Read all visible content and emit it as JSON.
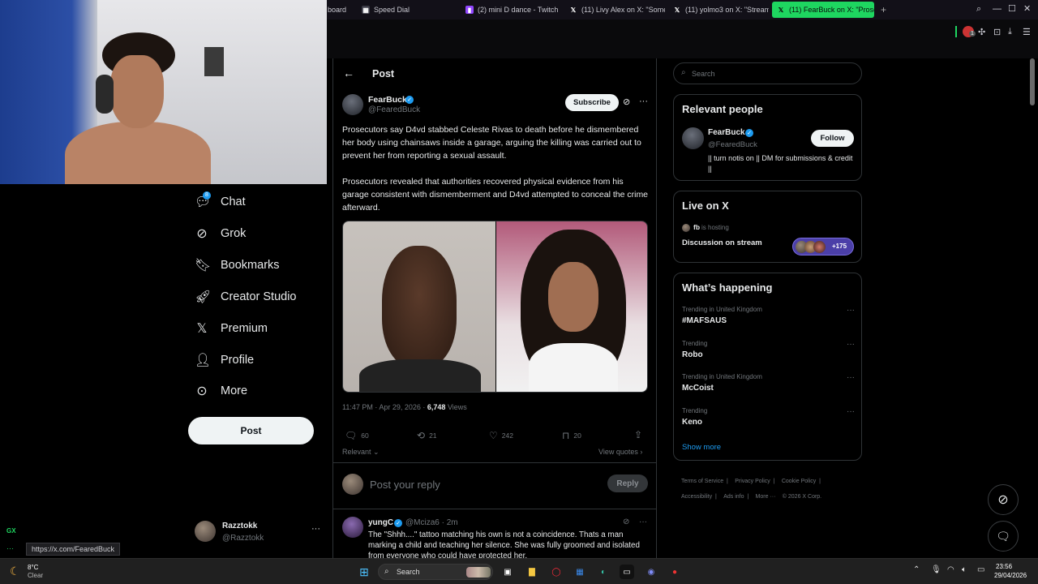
{
  "browser": {
    "tabs": [
      {
        "label": "board"
      },
      {
        "label": "Speed Dial"
      },
      {
        "label": "(2) mini D dance - Twitch"
      },
      {
        "label": "(11) Livy Alex on X: \"Some"
      },
      {
        "label": "(11) yolmo3 on X: \"Stream"
      },
      {
        "label": "(11) FearBuck on X: \"Prose",
        "active": true
      }
    ],
    "new_tab": "+",
    "gx_label": "GX",
    "toolbar_badge": "1"
  },
  "nav": {
    "chat_badge": "8",
    "items": [
      {
        "label": "Chat",
        "icon": "chat-icon"
      },
      {
        "label": "Grok",
        "icon": "grok-icon"
      },
      {
        "label": "Bookmarks",
        "icon": "bookmark-icon"
      },
      {
        "label": "Creator Studio",
        "icon": "rocket-icon"
      },
      {
        "label": "Premium",
        "icon": "x-logo-icon"
      },
      {
        "label": "Profile",
        "icon": "person-icon"
      },
      {
        "label": "More",
        "icon": "more-circle-icon"
      }
    ],
    "post_button": "Post",
    "account": {
      "name": "Razztokk",
      "handle": "@Razztokk",
      "menu": "···"
    }
  },
  "status_url": "https://x.com/FearedBuck",
  "post": {
    "header_title": "Post",
    "author_name": "FearBuck",
    "author_handle": "@FearedBuck",
    "subscribe_label": "Subscribe",
    "text_p1": "Prosecutors say D4vd stabbed Celeste Rivas to death before he dismembered her body using chainsaws inside a garage, arguing the killing was carried out to prevent her from reporting a sexual assault.",
    "text_p2": "Prosecutors revealed that authorities recovered physical evidence from his garage consistent with dismemberment and D4vd attempted to conceal the crime afterward.",
    "timestamp": "11:47 PM · Apr 29, 2026 · ",
    "views_count": "6,748",
    "views_label": " Views",
    "replies": "60",
    "reposts": "21",
    "likes": "242",
    "bookmarks": "20",
    "sort_label": "Relevant",
    "view_quotes": "View quotes",
    "reply_placeholder": "Post your reply",
    "reply_button": "Reply",
    "reply": {
      "author_name": "yungC",
      "author_handle": "@Mciza6 · 2m",
      "text": "The \"Shhh....\" tattoo matching his own is not a coincidence. Thats a man marking a child and teaching her silence. She was fully groomed and isolated from everyone who could have protected her."
    }
  },
  "sidebar": {
    "search_placeholder": "Search",
    "relevant_title": "Relevant people",
    "person": {
      "name": "FearBuck",
      "handle": "@FearedBuck",
      "bio": "|| turn notis on || DM for submissions & credit ||",
      "follow_label": "Follow"
    },
    "live_title": "Live on X",
    "live_host": "fb",
    "live_hosting": " is hosting",
    "live_topic": "Discussion on stream",
    "live_count": "+175",
    "happening_title": "What’s happening",
    "trends": [
      {
        "context": "Trending in United Kingdom",
        "name": "#MAFSAUS"
      },
      {
        "context": "Trending",
        "name": "Robo"
      },
      {
        "context": "Trending in United Kingdom",
        "name": "McCoist"
      },
      {
        "context": "Trending",
        "name": "Keno"
      }
    ],
    "show_more": "Show more",
    "footer": {
      "terms": "Terms of Service",
      "privacy": "Privacy Policy",
      "cookie": "Cookie Policy",
      "accessibility": "Accessibility",
      "ads": "Ads info",
      "more": "More ···",
      "copyright": "© 2026 X Corp."
    }
  },
  "taskbar": {
    "weather_temp": "8°C",
    "weather_desc": "Clear",
    "search_label": "Search",
    "time": "23:56",
    "date": "29/04/2026"
  }
}
